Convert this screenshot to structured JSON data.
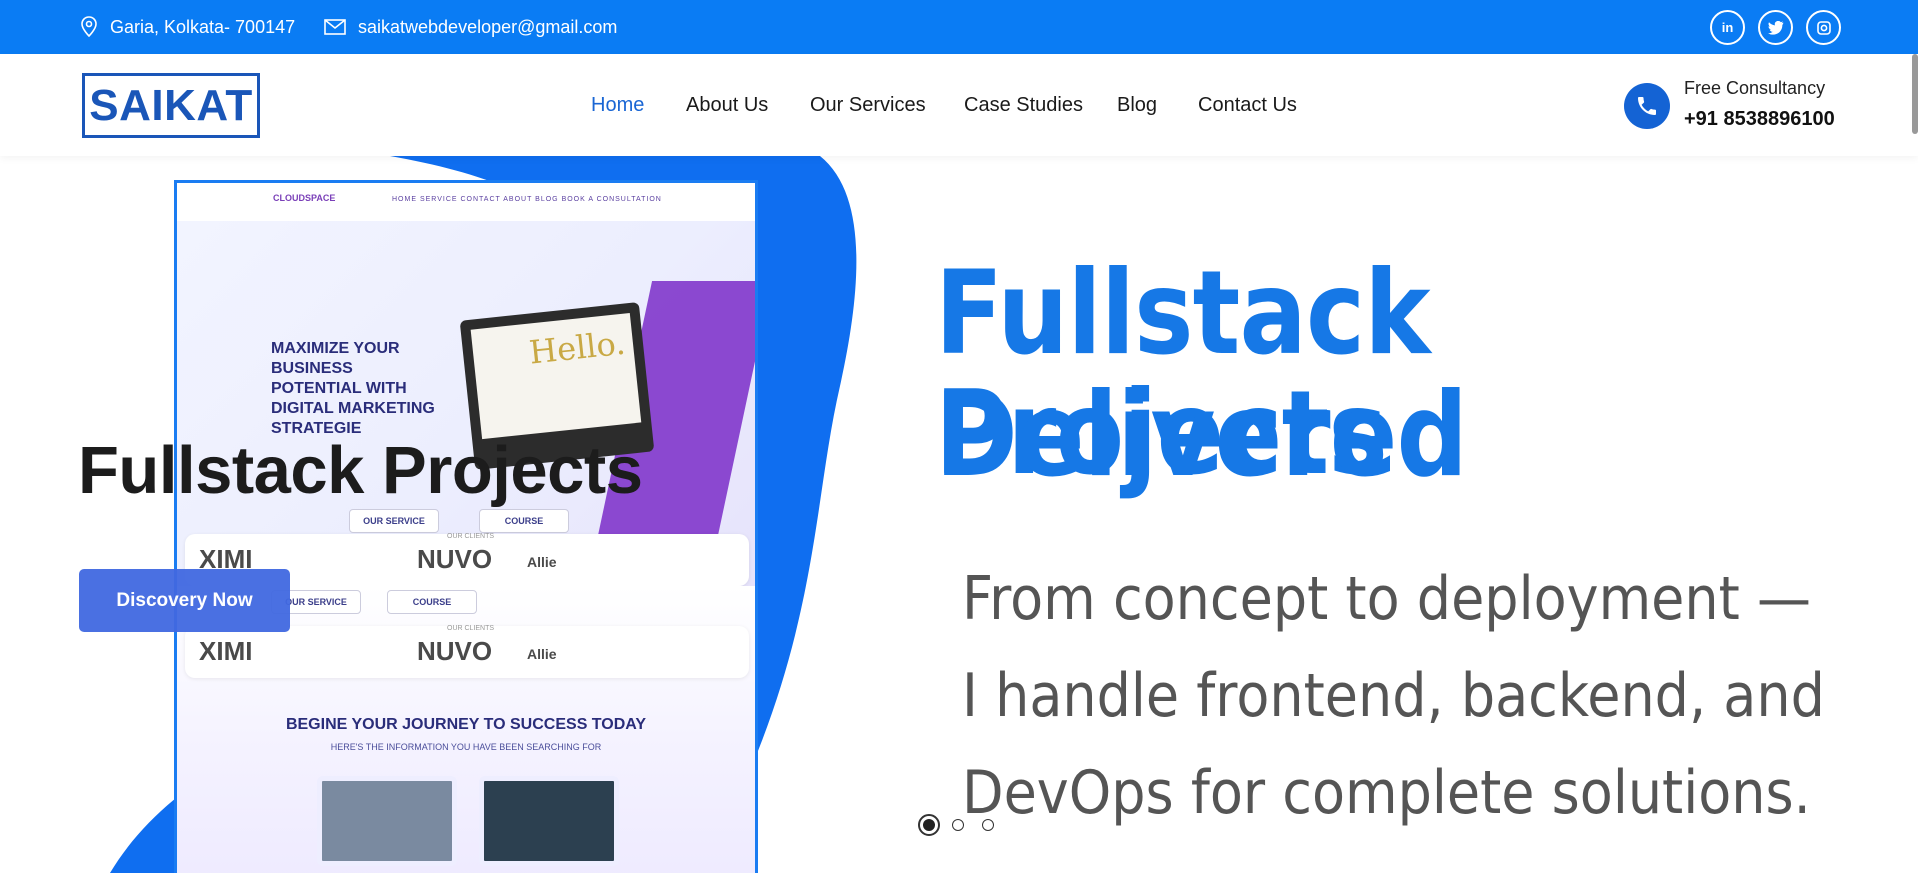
{
  "topbar": {
    "location": "Garia, Kolkata- 700147",
    "email": "saikatwebdeveloper@gmail.com",
    "social": [
      "linkedin-icon",
      "twitter-icon",
      "instagram-icon"
    ]
  },
  "header": {
    "logo": "SAIKAT",
    "nav": [
      "Home",
      "About Us",
      "Our Services",
      "Case Studies",
      "Blog",
      "Contact Us"
    ],
    "active_nav": "Home",
    "consult_label": "Free Consultancy",
    "consult_phone": "+91 8538896100"
  },
  "hero": {
    "title": "Fullstack Projects",
    "cta": "Discovery Now",
    "banner_line1": "Fullstack Projects",
    "banner_line2": "Delivered",
    "sub_line1": "From concept to deployment —",
    "sub_line2": "I handle frontend, backend, and",
    "sub_line3": "DevOps for complete solutions.",
    "slide_count": 3,
    "active_slide": 1
  },
  "mockup": {
    "logo": "CLOUDSPACE",
    "links": "HOME   SERVICE   CONTACT   ABOUT   BLOG   BOOK A CONSULTATION",
    "headline": [
      "MAXIMIZE YOUR",
      "BUSINESS",
      "POTENTIAL WITH",
      "DIGITAL MARKETING",
      "STRATEGIE"
    ],
    "hello": "Hello.",
    "tab1": "OUR SERVICE",
    "tab2": "COURSE",
    "clients_label": "OUR CLIENTS",
    "clients": [
      "XIMI",
      "NUVO",
      "Allie"
    ],
    "journey": "BEGINE YOUR JOURNEY TO SUCCESS TODAY",
    "journey_sub": "HERE'S THE INFORMATION YOU HAVE BEEN SEARCHING FOR"
  },
  "colors": {
    "primary": "#0a7cf4",
    "nav_active": "#1a66d4",
    "cta": "#4169e1",
    "banner_text": "#1678e6"
  }
}
